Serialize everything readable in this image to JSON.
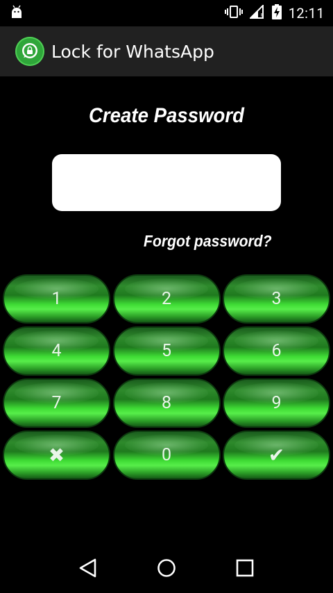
{
  "status_bar": {
    "time": "12:11",
    "icons": [
      "android-debug-icon",
      "vibrate-icon",
      "signal-icon",
      "battery-charging-icon"
    ]
  },
  "action_bar": {
    "title": "Lock for WhatsApp",
    "icon": "lock-bubble-icon"
  },
  "main": {
    "title": "Create Password",
    "password_value": "",
    "forgot_label": "Forgot password?"
  },
  "keypad": {
    "keys": [
      "1",
      "2",
      "3",
      "4",
      "5",
      "6",
      "7",
      "8",
      "9",
      "✖",
      "0",
      "✔"
    ],
    "accent_color": "#3fdc35"
  },
  "nav_bar": {
    "icons": [
      "back-icon",
      "home-icon",
      "recents-icon"
    ]
  }
}
